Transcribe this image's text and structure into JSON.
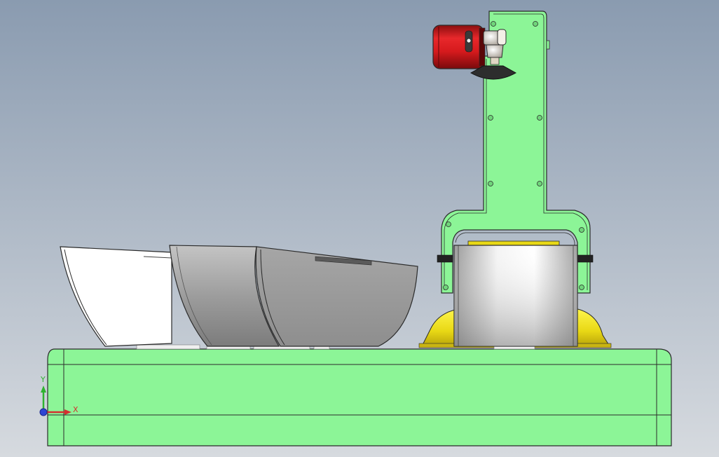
{
  "scene": {
    "background_top": "#8a9bb0",
    "background_bottom": "#d5d9df",
    "part_green": "#8cf597",
    "part_outline": "#2b2b2b",
    "accent_red": "#d4191c",
    "accent_yellow": "#ecdd1c",
    "dark_gray": "#888888",
    "light_gray": "#e8e8e8"
  },
  "triad": {
    "x_label": "X",
    "y_label": "Y",
    "x_color": "#d43030",
    "y_color": "#2fb32f",
    "z_color": "#2f45d4"
  }
}
